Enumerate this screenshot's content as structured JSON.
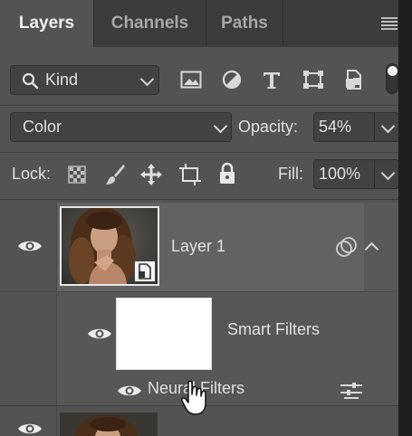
{
  "tabs": [
    "Layers",
    "Channels",
    "Paths"
  ],
  "filter": {
    "kind_label": "Kind",
    "icons": [
      "image-filter-icon",
      "adjustment-filter-icon",
      "type-filter-icon",
      "shape-filter-icon",
      "smart-object-filter-icon",
      "filter-toggle"
    ]
  },
  "blend": {
    "mode": "Color",
    "opacity_label": "Opacity:",
    "opacity_value": "54%"
  },
  "lock": {
    "label": "Lock:",
    "fill_label": "Fill:",
    "fill_value": "100%"
  },
  "layers": [
    {
      "name": "Layer 1",
      "visible": true,
      "type": "smart-object"
    },
    {
      "name": "Smart Filters",
      "visible": true
    },
    {
      "name": "Neural Filters",
      "visible": true
    }
  ],
  "colors": {
    "panel": "#535353",
    "tabbar": "#3c3c3c",
    "field": "#424242",
    "highlight": "#626262"
  }
}
